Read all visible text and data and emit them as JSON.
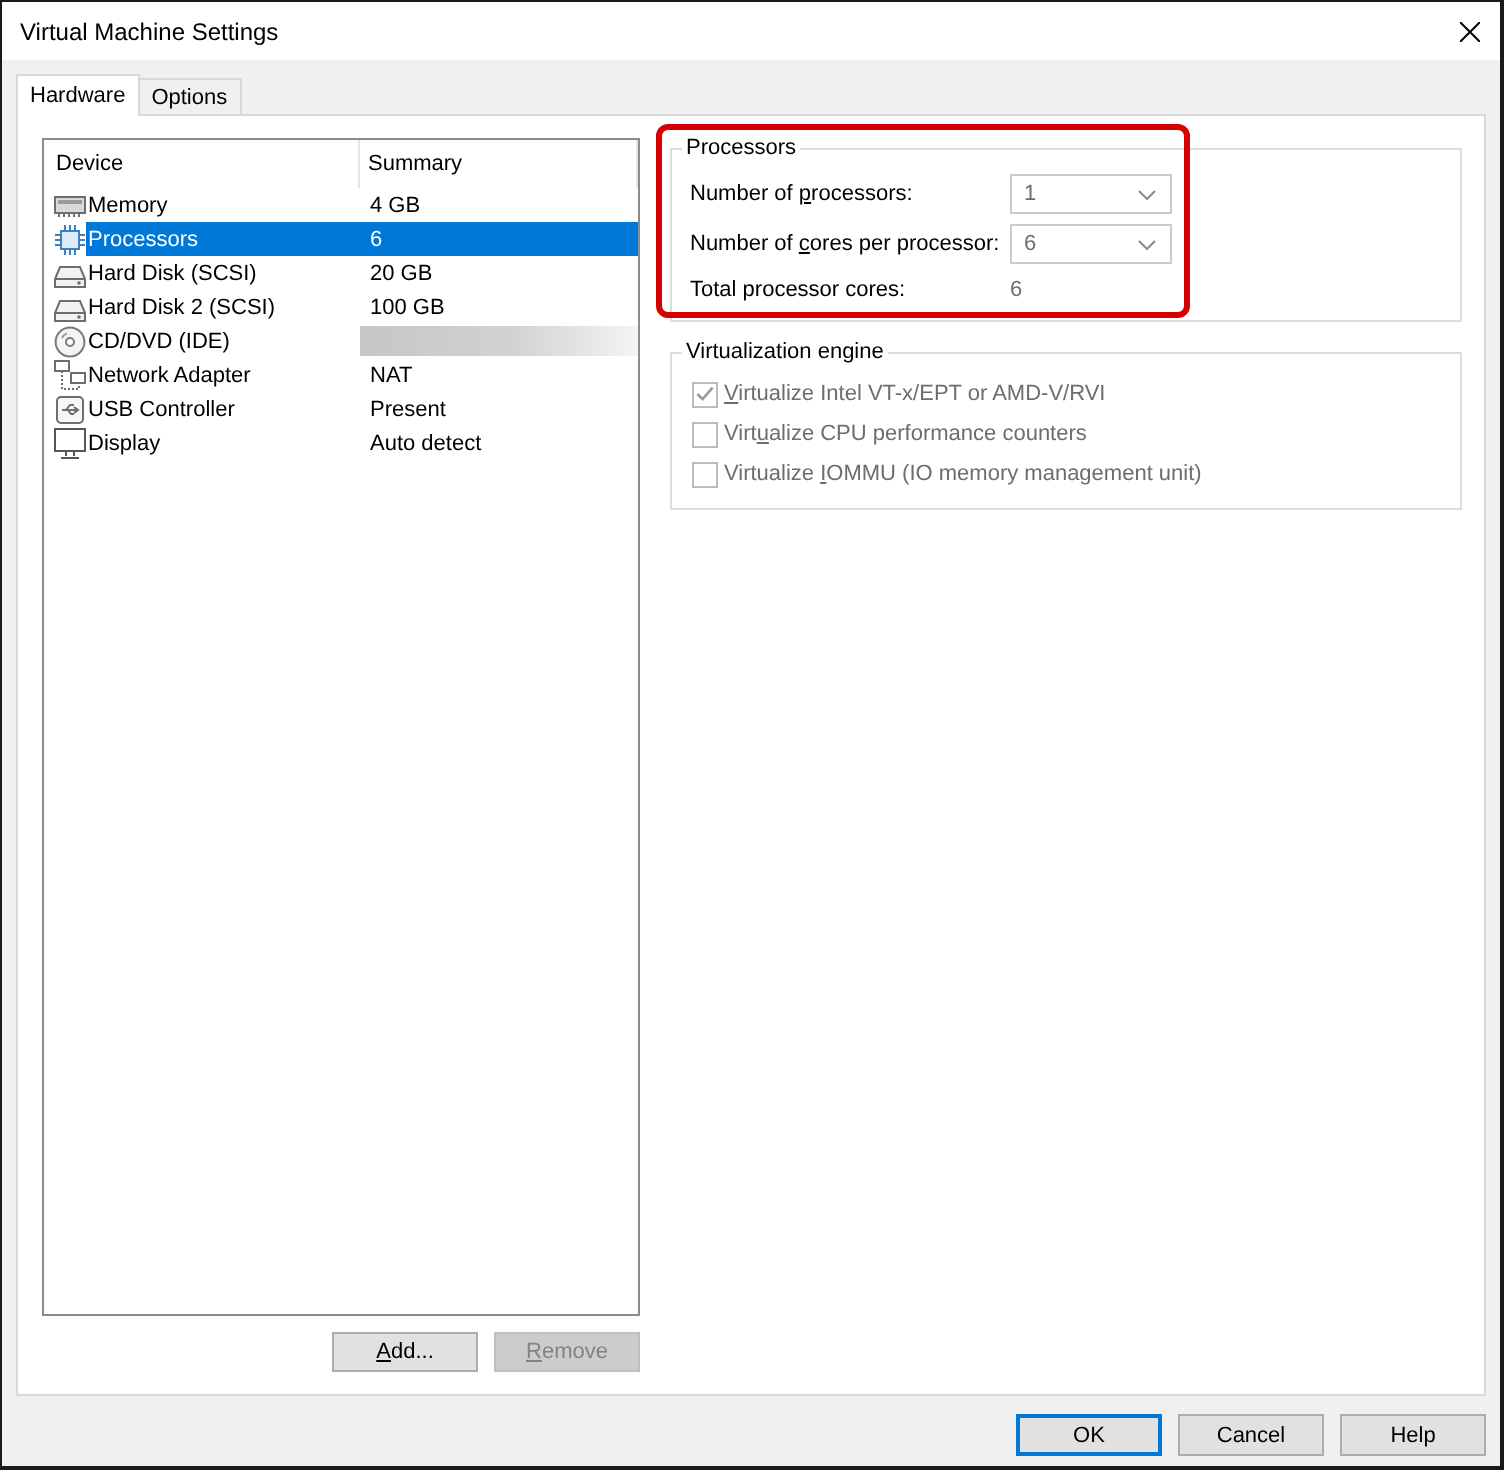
{
  "window": {
    "title": "Virtual Machine Settings"
  },
  "tabs": [
    {
      "label": "Hardware",
      "selected": true
    },
    {
      "label": "Options",
      "selected": false
    }
  ],
  "device_list": {
    "columns": [
      "Device",
      "Summary"
    ],
    "rows": [
      {
        "kind": "memory",
        "device": "Memory",
        "summary": "4 GB",
        "selected": false
      },
      {
        "kind": "cpu",
        "device": "Processors",
        "summary": "6",
        "selected": true
      },
      {
        "kind": "disk",
        "device": "Hard Disk (SCSI)",
        "summary": "20 GB",
        "selected": false
      },
      {
        "kind": "disk",
        "device": "Hard Disk 2 (SCSI)",
        "summary": "100 GB",
        "selected": false
      },
      {
        "kind": "cdrom",
        "device": "CD/DVD (IDE)",
        "summary_redacted": true,
        "selected": false
      },
      {
        "kind": "network",
        "device": "Network Adapter",
        "summary": "NAT",
        "selected": false
      },
      {
        "kind": "usb",
        "device": "USB Controller",
        "summary": "Present",
        "selected": false
      },
      {
        "kind": "display",
        "device": "Display",
        "summary": "Auto detect",
        "selected": false
      }
    ]
  },
  "list_buttons": [
    {
      "label": {
        "key": "A",
        "post": "dd..."
      },
      "disabled": false
    },
    {
      "label": {
        "key": "R",
        "post": "emove"
      },
      "disabled": true
    }
  ],
  "processors": {
    "title": "Processors",
    "highlighted": true,
    "fields": [
      {
        "kind": "combo",
        "label": {
          "pre": "Number of ",
          "key": "p",
          "post": "rocessors:"
        },
        "value": "1",
        "disabled": true
      },
      {
        "kind": "combo",
        "label": {
          "pre": "Number of ",
          "key": "c",
          "post": "ores per processor:"
        },
        "value": "6",
        "disabled": true
      },
      {
        "kind": "readout",
        "label": {
          "pre": "Total processor cores:"
        },
        "value": "6",
        "disabled": true
      }
    ]
  },
  "virtualization": {
    "title": "Virtualization engine",
    "options": [
      {
        "label": {
          "key": "V",
          "post": "irtualize Intel VT-x/EPT or AMD-V/RVI"
        },
        "checked": true,
        "disabled": true
      },
      {
        "label": {
          "pre": "Virt",
          "key": "u",
          "post": "alize CPU performance counters"
        },
        "checked": false,
        "disabled": true
      },
      {
        "label": {
          "pre": "Virtualize ",
          "key": "I",
          "post": "OMMU (IO memory management unit)"
        },
        "checked": false,
        "disabled": true
      }
    ]
  },
  "dialog_buttons": [
    {
      "label": "OK",
      "default": true
    },
    {
      "label": "Cancel",
      "default": false
    },
    {
      "label": "Help",
      "default": false
    }
  ]
}
